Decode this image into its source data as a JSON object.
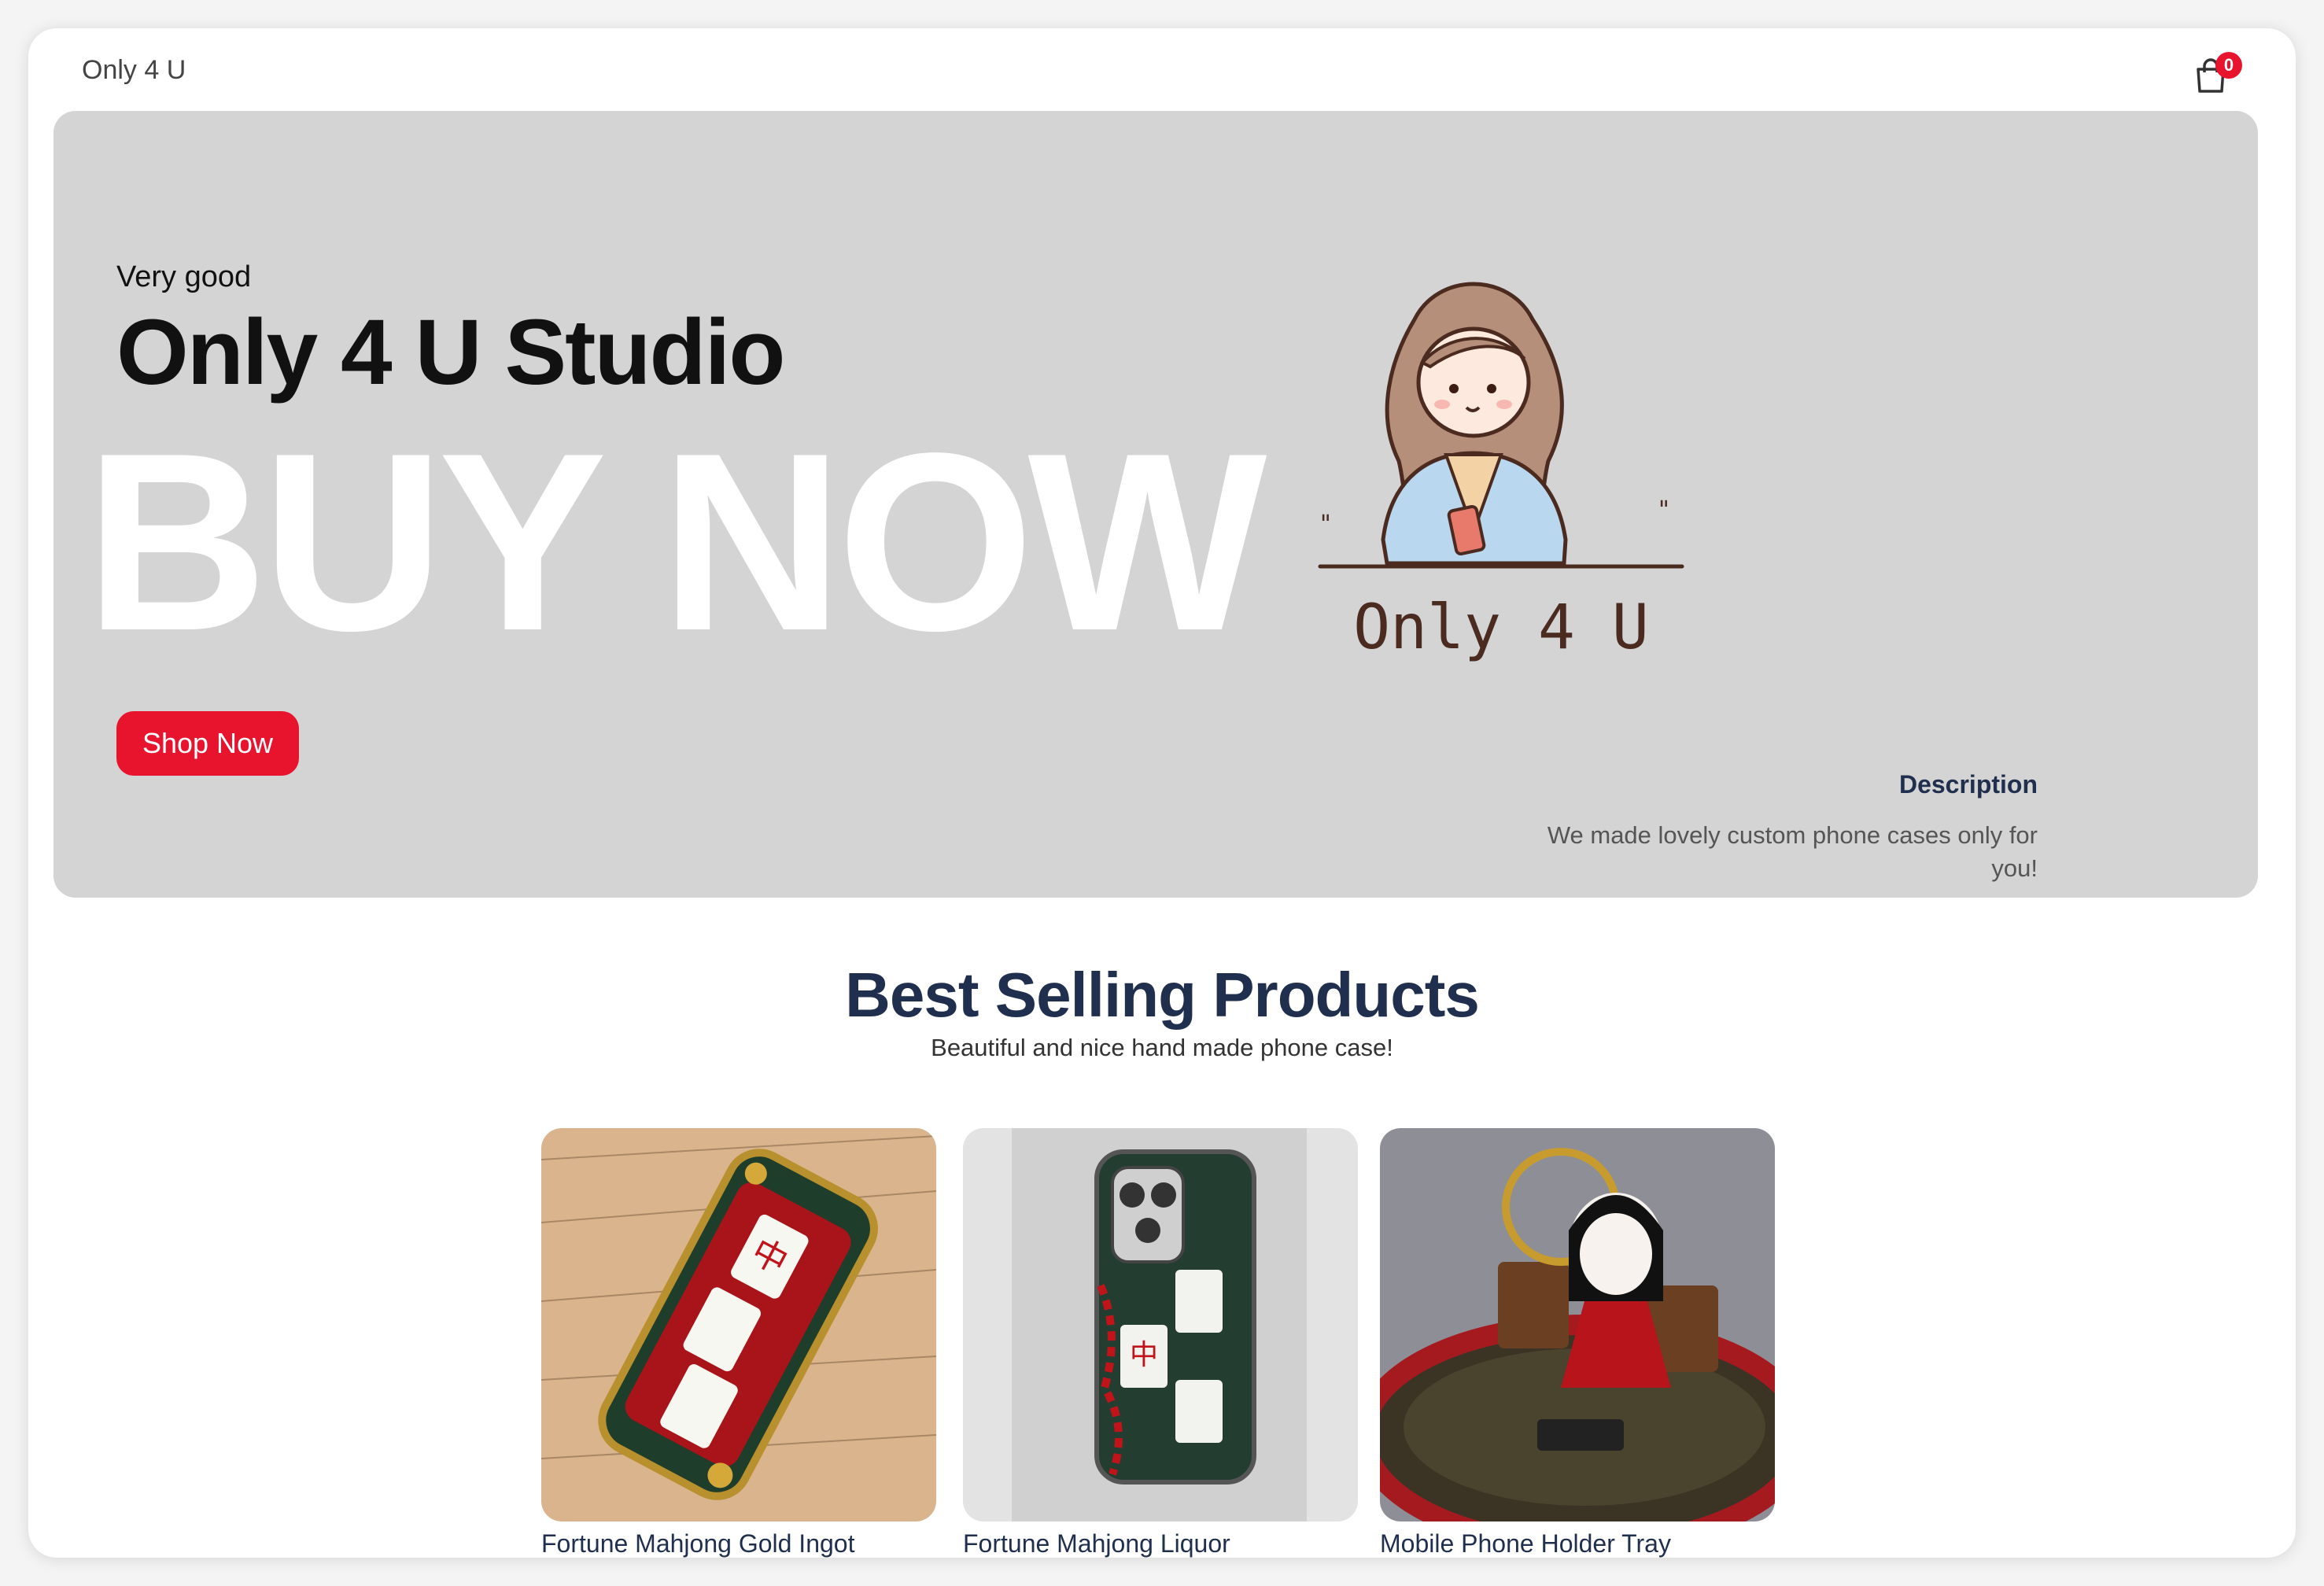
{
  "header": {
    "brand": "Only 4 U",
    "cart_count": "0"
  },
  "hero": {
    "kicker": "Very good",
    "title": "Only 4 U Studio",
    "big_text": "BUY NOW",
    "button_label": "Shop Now",
    "logo_text": "Only 4 U",
    "description_title": "Description",
    "description_text": "We made lovely custom phone cases only for you!"
  },
  "best_selling": {
    "title": "Best Selling Products",
    "subtitle": "Beautiful and nice hand made phone case!",
    "products": [
      {
        "name": "Fortune Mahjong Gold Ingot"
      },
      {
        "name": "Fortune Mahjong Liquor"
      },
      {
        "name": "Mobile Phone Holder Tray"
      }
    ]
  },
  "colors": {
    "accent": "#e8142e",
    "heading": "#1f2f4d",
    "hero_bg": "#d4d4d4"
  }
}
